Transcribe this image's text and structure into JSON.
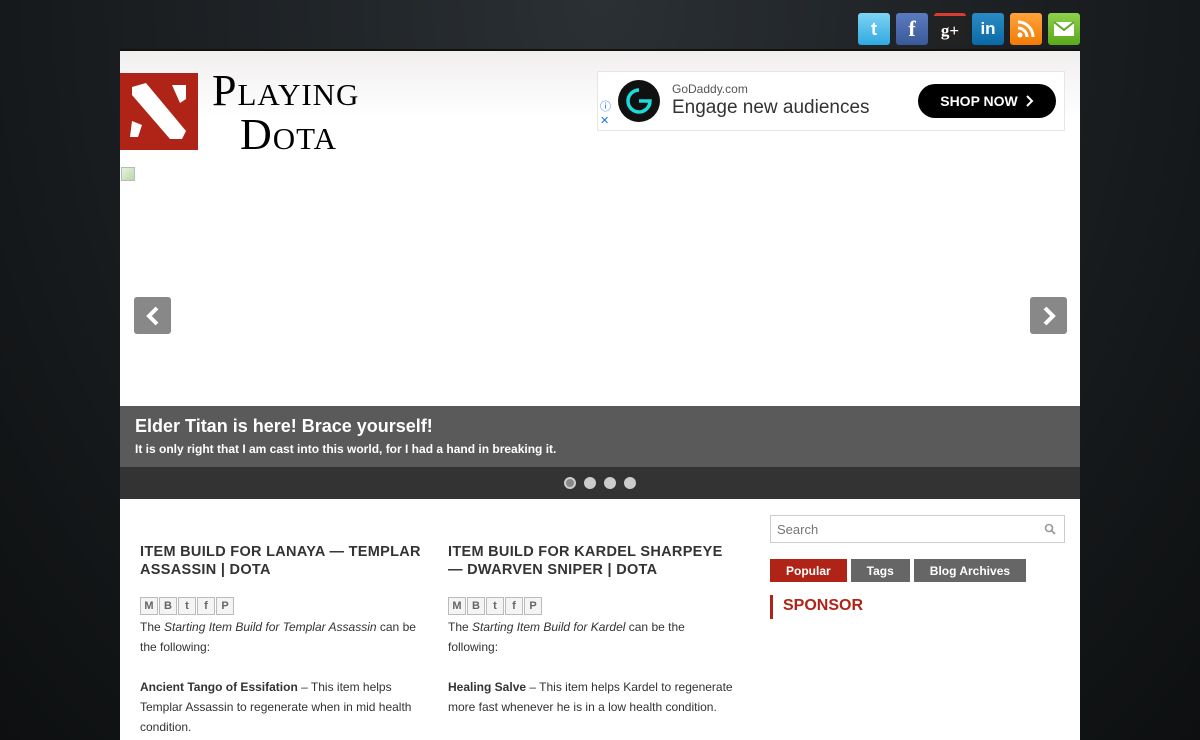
{
  "social": [
    {
      "name": "twitter-icon",
      "glyph": "t"
    },
    {
      "name": "facebook-icon",
      "glyph": "f"
    },
    {
      "name": "google-plus-icon",
      "glyph": "g+"
    },
    {
      "name": "linkedin-icon",
      "glyph": "in"
    },
    {
      "name": "rss-icon",
      "glyph": ""
    },
    {
      "name": "mail-icon",
      "glyph": ""
    }
  ],
  "header": {
    "logo_line1": "Playing",
    "logo_line2": "Dota"
  },
  "ad": {
    "source": "GoDaddy.com",
    "headline": "Engage new audiences",
    "button": "SHOP NOW"
  },
  "slider": {
    "caption_title": "Elder Titan is here! Brace yourself!",
    "caption_sub": "It is only right that I am cast into this world, for I had a hand in breaking it.",
    "slides": 4,
    "active_slide": 1
  },
  "posts": [
    {
      "title": "Item Build for Lanaya — Templar Assassin | DotA",
      "intro_pre": "The ",
      "intro_em": "Starting Item Build for Templar Assassin",
      "intro_post": " can be the following:",
      "item_name": "Ancient Tango of Essifation",
      "item_desc": " – This item helps Templar Assassin to regenerate when in mid health condition."
    },
    {
      "title": "Item Build for Kardel Sharpeye — Dwarven Sniper | DotA",
      "intro_pre": "The ",
      "intro_em": "Starting Item Build for Kardel",
      "intro_post": " can be the following:",
      "item_name": "Healing Salve",
      "item_desc": " – This item helps Kardel to regenerate more fast whenever he is in a low health condition."
    }
  ],
  "sidebar": {
    "search_placeholder": "Search",
    "tabs": [
      "Popular",
      "Tags",
      "Blog Archives"
    ],
    "sponsor_heading": "SPONSOR"
  },
  "colors": {
    "accent": "#b02418",
    "caption_bg": "#5a5a5a"
  }
}
